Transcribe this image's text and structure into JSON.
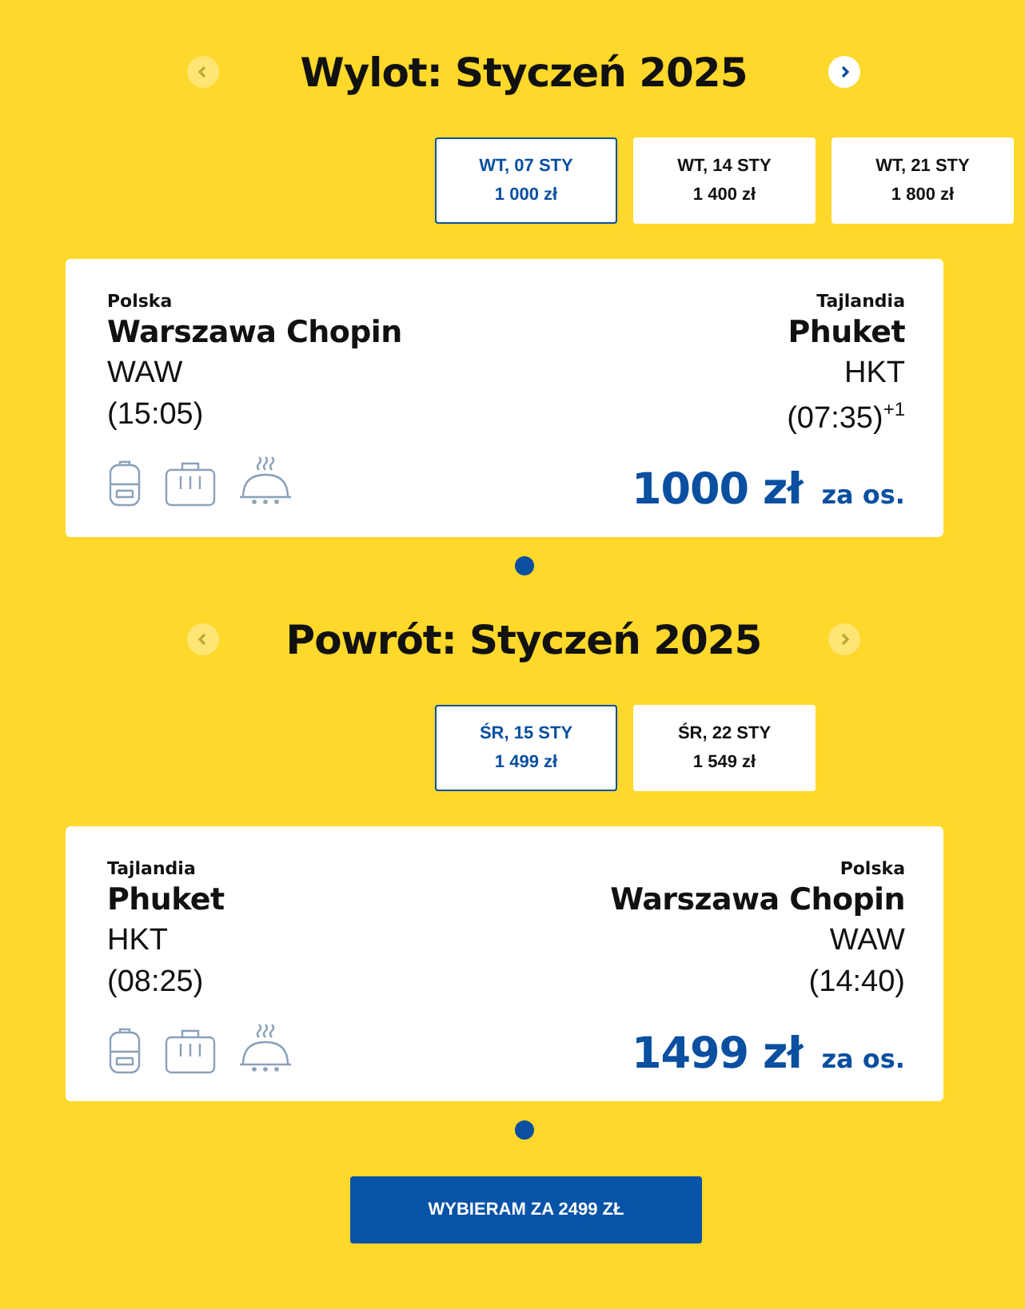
{
  "sections": [
    {
      "title": "Wylot: Styczeń 2025",
      "prev_disabled": true,
      "next_disabled": false,
      "dates": [
        {
          "label": "WT, 07 STY",
          "price": "1 000 zł",
          "selected": true
        },
        {
          "label": "WT, 14 STY",
          "price": "1 400 zł",
          "selected": false
        },
        {
          "label": "WT, 21 STY",
          "price": "1 800 zł",
          "selected": false
        }
      ],
      "flight": {
        "from_country": "Polska",
        "from_city": "Warszawa Chopin",
        "from_code": "WAW",
        "from_time": "(15:05)",
        "to_country": "Tajlandia",
        "to_city": "Phuket",
        "to_code": "HKT",
        "to_time": "(07:35)$^{+1}$",
        "price": "1000 zł",
        "per": "za os."
      }
    },
    {
      "title": "Powrót: Styczeń 2025",
      "prev_disabled": true,
      "next_disabled": true,
      "dates": [
        {
          "label": "ŚR, 15 STY",
          "price": "1 499 zł",
          "selected": true
        },
        {
          "label": "ŚR, 22 STY",
          "price": "1 549 zł",
          "selected": false
        }
      ],
      "flight": {
        "from_country": "Tajlandia",
        "from_city": "Phuket",
        "from_code": "HKT",
        "from_time": "(08:25)",
        "to_country": "Polska",
        "to_city": "Warszawa Chopin",
        "to_code": "WAW",
        "to_time": "(14:40)",
        "price": "1499 zł",
        "per": "za os."
      }
    }
  ],
  "confirm_button": "WYBIERAM ZA 2499 ZŁ"
}
